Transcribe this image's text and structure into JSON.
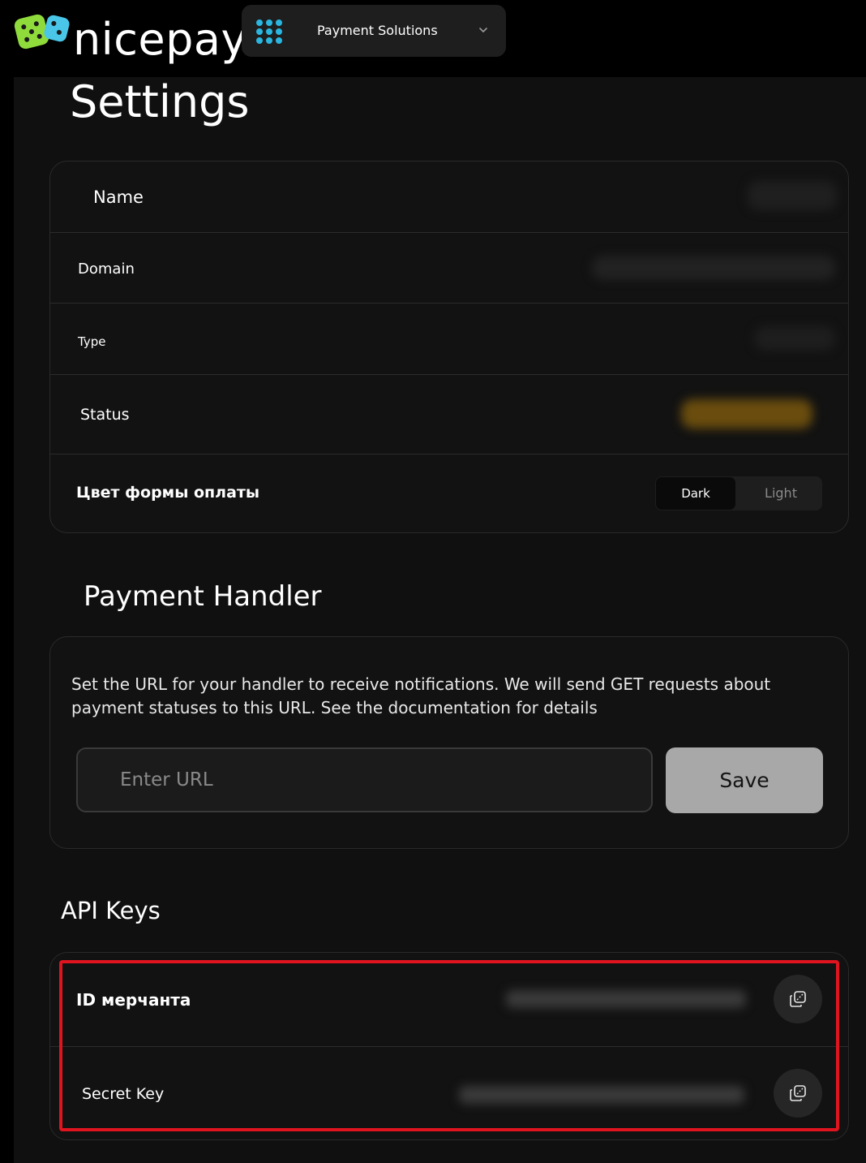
{
  "header": {
    "logo_text": "nicepay",
    "switcher_label": "Payment Solutions",
    "switcher_icon": "grid-dots-icon",
    "chevron_icon": "chevron-down-icon"
  },
  "page": {
    "title": "Settings"
  },
  "info": {
    "rows": [
      {
        "label": "Name"
      },
      {
        "label": "Domain"
      },
      {
        "label": "Type"
      },
      {
        "label": "Status"
      }
    ],
    "theme_label": "Цвет формы оплаты",
    "theme_options": {
      "dark": "Dark",
      "light": "Light"
    },
    "theme_selected": "Dark"
  },
  "handler": {
    "title": "Payment Handler",
    "description": "Set the URL for your handler to receive notifications. We will send GET requests about payment statuses to this URL. See the documentation for details",
    "url_placeholder": "Enter URL",
    "url_value": "",
    "save_label": "Save"
  },
  "api_keys": {
    "title": "API Keys",
    "merchant_id_label": "ID мерчанта",
    "secret_key_label": "Secret Key",
    "copy_icon": "copy-icon"
  },
  "colors": {
    "background": "#101010",
    "card": "#121212",
    "status_accent": "#c8941a",
    "highlight": "#e0141e",
    "switcher_icon": "#2ab6e0"
  }
}
